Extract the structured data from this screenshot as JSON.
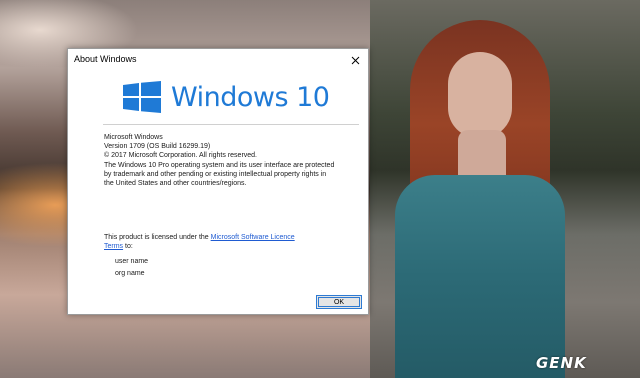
{
  "dialog": {
    "title": "About Windows",
    "logo_text": "Windows 10",
    "product_name": "Microsoft Windows",
    "version": "Version 1709 (OS Build 16299.19)",
    "copyright": "© 2017 Microsoft Corporation. All rights reserved.",
    "legal_lines": [
      "The Windows 10 Pro operating system and its user interface are protected",
      "by trademark and other pending or existing intellectual property rights in",
      "the United States and other countries/regions."
    ],
    "license_prefix": "This product is licensed under the ",
    "license_link_1": "Microsoft Software Licence",
    "license_link_2": "Terms",
    "license_suffix": " to:",
    "user_name": "user name",
    "org_name": "org name",
    "ok_label": "OK"
  },
  "watermark": {
    "text": "GENK"
  },
  "colors": {
    "windows_blue": "#1f7ad6",
    "link_blue": "#1f5bd1",
    "ok_border": "#2e7ad2"
  },
  "icons": {
    "close": "close-icon",
    "logo": "windows-logo-icon"
  }
}
